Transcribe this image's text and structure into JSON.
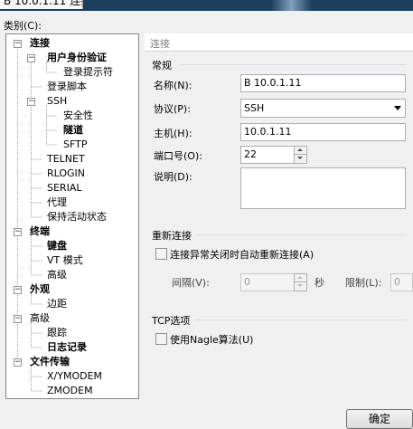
{
  "window": {
    "title": "B 10.0.1.11 连接"
  },
  "category_label": "类别(C):",
  "tree": [
    {
      "label": "连接",
      "bold": true,
      "expander": "−"
    },
    {
      "label": "用户身份验证",
      "bold": true,
      "expander": "−"
    },
    {
      "label": "登录提示符",
      "bold": false
    },
    {
      "label": "登录脚本",
      "bold": false
    },
    {
      "label": "SSH",
      "bold": false,
      "expander": "−"
    },
    {
      "label": "安全性",
      "bold": false
    },
    {
      "label": "隧道",
      "bold": true
    },
    {
      "label": "SFTP",
      "bold": false
    },
    {
      "label": "TELNET",
      "bold": false
    },
    {
      "label": "RLOGIN",
      "bold": false
    },
    {
      "label": "SERIAL",
      "bold": false
    },
    {
      "label": "代理",
      "bold": false
    },
    {
      "label": "保持活动状态",
      "bold": false
    },
    {
      "label": "终端",
      "bold": true,
      "expander": "−"
    },
    {
      "label": "键盘",
      "bold": true
    },
    {
      "label": "VT 模式",
      "bold": false
    },
    {
      "label": "高级",
      "bold": false
    },
    {
      "label": "外观",
      "bold": true,
      "expander": "−"
    },
    {
      "label": "边距",
      "bold": false
    },
    {
      "label": "高级",
      "bold": false,
      "expander": "−"
    },
    {
      "label": "跟踪",
      "bold": false
    },
    {
      "label": "日志记录",
      "bold": true
    },
    {
      "label": "文件传输",
      "bold": true,
      "expander": "−"
    },
    {
      "label": "X/YMODEM",
      "bold": false
    },
    {
      "label": "ZMODEM",
      "bold": false
    }
  ],
  "page": {
    "title": "连接",
    "general": {
      "title": "常规",
      "name_label": "名称(N):",
      "name_value": "B 10.0.1.11",
      "protocol_label": "协议(P):",
      "protocol_value": "SSH",
      "host_label": "主机(H):",
      "host_value": "10.0.1.11",
      "port_label": "端口号(O):",
      "port_value": "22",
      "desc_label": "说明(D):"
    },
    "reconnect": {
      "title": "重新连接",
      "auto_label": "连接异常关闭时自动重新连接(A)",
      "interval_label": "间隔(V):",
      "interval_value": "0",
      "seconds_label": "秒",
      "limit_label": "限制(L):",
      "limit_value": "0"
    },
    "tcp": {
      "title": "TCP选项",
      "nagle_label": "使用Nagle算法(U)"
    }
  },
  "ok_label": "确定"
}
